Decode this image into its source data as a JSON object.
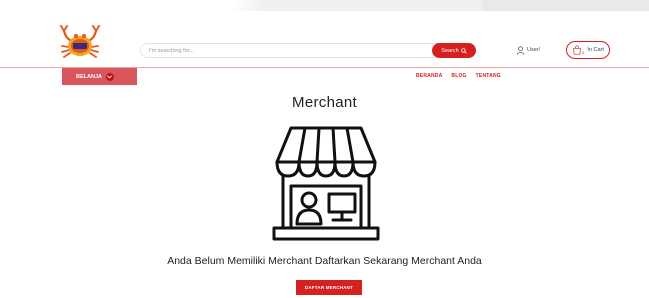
{
  "header": {
    "logo_icon": "crab-logo-icon",
    "search": {
      "placeholder": "I'm searching for..."
    },
    "search_button": {
      "label": "Search",
      "icon": "search-icon"
    },
    "user_link": {
      "label": "User!",
      "icon": "user-icon"
    },
    "cart_button": {
      "label": "In Cart",
      "count": "0",
      "icon": "shopping-bag-icon"
    }
  },
  "category_menu": {
    "label": "BELANJA",
    "icon": "chevron-down-icon"
  },
  "nav": {
    "items": [
      "BERANDA",
      "BLOG",
      "TENTANG"
    ]
  },
  "main": {
    "title": "Merchant",
    "illustration_icon": "storefront-icon",
    "message": "Anda Belum Memiliki Merchant Daftarkan Sekarang Merchant Anda",
    "cta_label": "DAFTAR MERCHANT"
  },
  "colors": {
    "accent": "#d62020",
    "menu_bg": "#d9575a",
    "rule": "#e8a6a6"
  }
}
